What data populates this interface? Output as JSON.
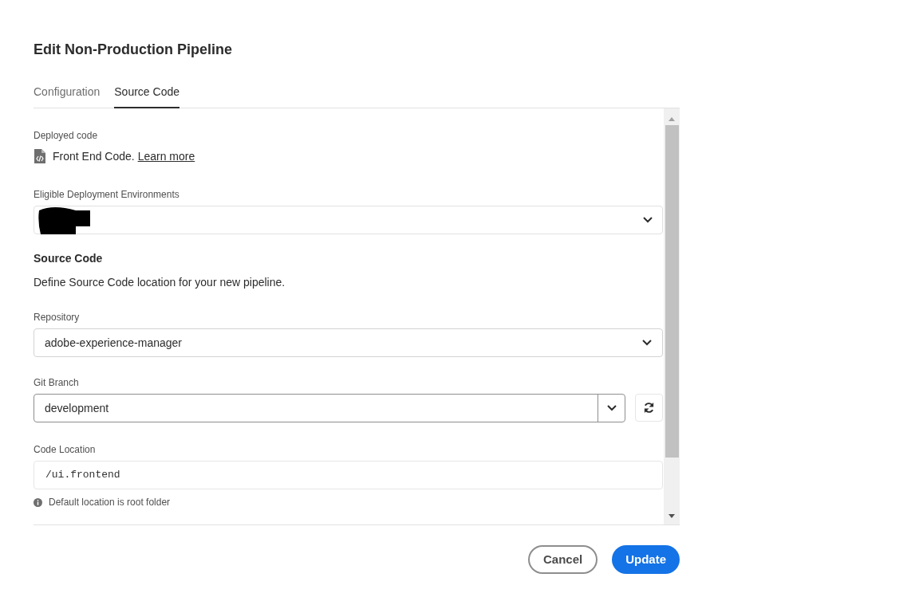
{
  "dialog": {
    "title": "Edit Non-Production Pipeline"
  },
  "tabs": [
    {
      "label": "Configuration",
      "selected": false
    },
    {
      "label": "Source Code",
      "selected": true
    }
  ],
  "deployed_code": {
    "label": "Deployed code",
    "text": "Front End Code.",
    "link": "Learn more"
  },
  "environments": {
    "label": "Eligible Deployment Environments"
  },
  "source_code": {
    "heading": "Source Code",
    "description": "Define Source Code location for your new pipeline."
  },
  "repository": {
    "label": "Repository",
    "value": "adobe-experience-manager"
  },
  "git_branch": {
    "label": "Git Branch",
    "value": "development"
  },
  "code_location": {
    "label": "Code Location",
    "value": "/ui.frontend",
    "hint": "Default location is root folder"
  },
  "buttons": [
    {
      "label": "Cancel",
      "kind": "secondary"
    },
    {
      "label": "Update",
      "kind": "primary"
    }
  ]
}
